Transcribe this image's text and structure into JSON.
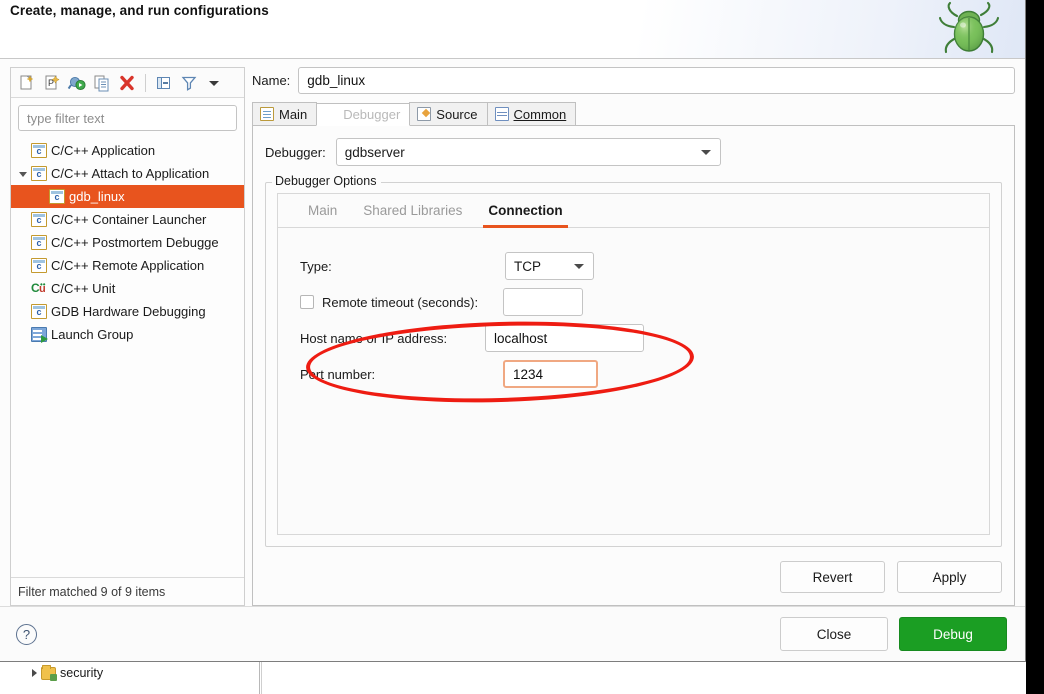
{
  "dialog": {
    "title": "Create, manage, and run configurations",
    "banner_icon": "bug-icon"
  },
  "sidebar": {
    "toolbar": [
      {
        "name": "new-configuration-icon",
        "tooltip": "New launch configuration"
      },
      {
        "name": "new-prototype-icon",
        "tooltip": "New prototype"
      },
      {
        "name": "export-run-icon",
        "tooltip": "Export"
      },
      {
        "name": "duplicate-icon",
        "tooltip": "Duplicate"
      },
      {
        "name": "delete-icon",
        "tooltip": "Delete"
      },
      {
        "name": "collapse-all-icon",
        "tooltip": "Collapse All"
      },
      {
        "name": "filter-icon",
        "tooltip": "Filter launch configurations"
      },
      {
        "name": "view-menu-icon",
        "tooltip": "View Menu"
      }
    ],
    "filter_placeholder": "type filter text",
    "tree": [
      {
        "label": "C/C++ Application",
        "icon": "cdt-icon",
        "indent": 0,
        "twisty": "none",
        "selected": false
      },
      {
        "label": "C/C++ Attach to Application",
        "icon": "cdt-icon",
        "indent": 0,
        "twisty": "open",
        "selected": false
      },
      {
        "label": "gdb_linux",
        "icon": "cdt-icon",
        "indent": 1,
        "twisty": "none",
        "selected": true
      },
      {
        "label": "C/C++ Container Launcher",
        "icon": "cdt-icon",
        "indent": 0,
        "twisty": "none",
        "selected": false
      },
      {
        "label": "C/C++ Postmortem Debugge",
        "icon": "cdt-icon",
        "indent": 0,
        "twisty": "none",
        "selected": false
      },
      {
        "label": "C/C++ Remote Application",
        "icon": "cdt-icon",
        "indent": 0,
        "twisty": "none",
        "selected": false
      },
      {
        "label": "C/C++ Unit",
        "icon": "cunit-icon",
        "indent": 0,
        "twisty": "none",
        "selected": false
      },
      {
        "label": "GDB Hardware Debugging",
        "icon": "cdt-icon",
        "indent": 0,
        "twisty": "none",
        "selected": false
      },
      {
        "label": "Launch Group",
        "icon": "launch-group-icon",
        "indent": 0,
        "twisty": "none",
        "selected": false
      }
    ],
    "status": "Filter matched 9 of 9 items"
  },
  "config": {
    "name_label": "Name:",
    "name_value": "gdb_linux",
    "tabs": [
      {
        "label": "Main",
        "icon": "document-icon",
        "active": false
      },
      {
        "label": "Debugger",
        "icon": "bug-icon",
        "active": true
      },
      {
        "label": "Source",
        "icon": "source-icon",
        "active": false
      },
      {
        "label": "Common",
        "icon": "common-icon",
        "active": false,
        "mnemonic": "C"
      }
    ],
    "debugger_label": "Debugger:",
    "debugger_value": "gdbserver",
    "options_group_title": "Debugger Options",
    "inner_tabs": [
      {
        "label": "Main",
        "active": false
      },
      {
        "label": "Shared Libraries",
        "active": false
      },
      {
        "label": "Connection",
        "active": true
      }
    ],
    "connection": {
      "type_label": "Type:",
      "type_value": "TCP",
      "timeout_label": "Remote timeout (seconds):",
      "timeout_value": "",
      "timeout_checked": false,
      "host_label": "Host name or IP address:",
      "host_value": "localhost",
      "port_label": "Port number:",
      "port_value": "1234"
    },
    "revert_label": "Revert",
    "apply_label": "Apply"
  },
  "footer": {
    "help_glyph": "?",
    "close_label": "Close",
    "debug_label": "Debug"
  },
  "annotation": {
    "shape": "ellipse",
    "color": "#ee1c12",
    "targets": "host-and-port-fields"
  },
  "background": {
    "tree_item_label": "security"
  },
  "colors": {
    "selection": "#e8541e",
    "tab_indicator": "#e8541e",
    "debug_button": "#1b9e23",
    "focus_field_border": "#f0a882",
    "annotation": "#ee1c12"
  }
}
